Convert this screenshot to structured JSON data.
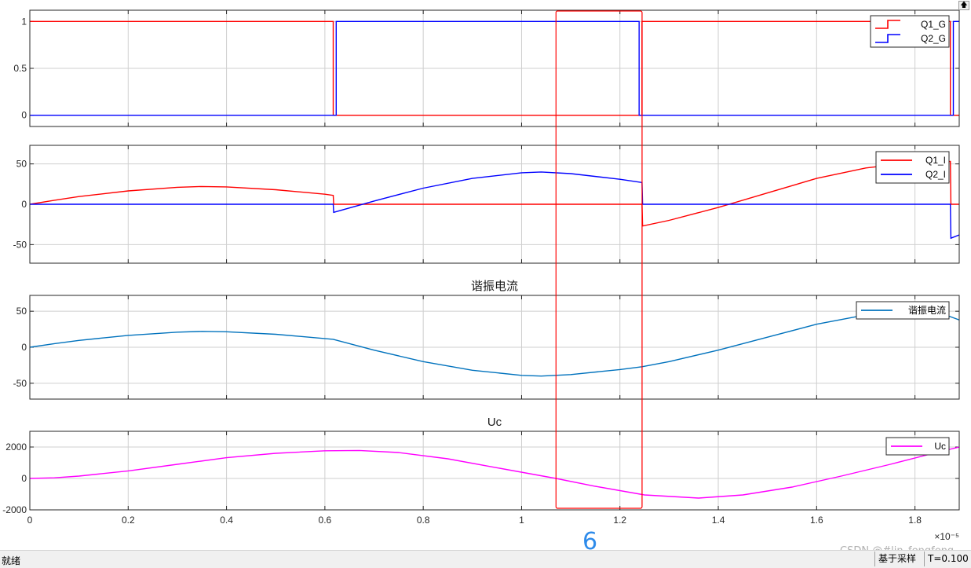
{
  "window": {
    "top_button_icon": "arrow-up-icon",
    "status": {
      "text": "就绪",
      "mode": "基于采样",
      "time": "T=0.100"
    }
  },
  "annotation": {
    "number": "6",
    "color": "#ff0000",
    "x_range": [
      1.07,
      1.245
    ]
  },
  "watermark": "CSDN @#lin_fengfeng",
  "x_exponent_label": "×10⁻⁵",
  "x_ticks": [
    0,
    0.2,
    0.4,
    0.6,
    0.8,
    1,
    1.2,
    1.4,
    1.6,
    1.8
  ],
  "x_tick_labels": [
    "0",
    "0.2",
    "0.4",
    "0.6",
    "0.8",
    "1",
    "1.2",
    "1.4",
    "1.6",
    "1.8"
  ],
  "chart_data": [
    {
      "type": "line",
      "title": "",
      "xlim": [
        0,
        1.89
      ],
      "ylim": [
        -0.12,
        1.12
      ],
      "yticks": [
        0,
        0.5,
        1
      ],
      "ytick_labels": [
        "0",
        "0.5",
        "1"
      ],
      "grid": true,
      "legend_position": "top-right",
      "series": [
        {
          "name": "Q1_G",
          "color": "#ff0000",
          "x": [
            0,
            0.617,
            0.617,
            1.245,
            1.245,
            1.872,
            1.872,
            1.89
          ],
          "y": [
            1,
            1,
            0,
            0,
            1,
            1,
            0,
            0
          ]
        },
        {
          "name": "Q2_G",
          "color": "#0000ff",
          "x": [
            0,
            0.623,
            0.623,
            1.239,
            1.239,
            1.878,
            1.878,
            1.89
          ],
          "y": [
            0,
            0,
            1,
            1,
            0,
            0,
            1,
            1
          ]
        }
      ]
    },
    {
      "type": "line",
      "title": "",
      "xlim": [
        0,
        1.89
      ],
      "ylim": [
        -73,
        73
      ],
      "yticks": [
        -50,
        0,
        50
      ],
      "ytick_labels": [
        "-50",
        "0",
        "50"
      ],
      "grid": true,
      "legend_position": "top-right",
      "series": [
        {
          "name": "Q1_I",
          "color": "#ff0000",
          "x": [
            0,
            0.05,
            0.1,
            0.2,
            0.3,
            0.35,
            0.4,
            0.5,
            0.6,
            0.617,
            0.618,
            1.245,
            1.246,
            1.3,
            1.4,
            1.5,
            1.6,
            1.7,
            1.8,
            1.872,
            1.873,
            1.89
          ],
          "y": [
            0,
            5,
            9.5,
            16.5,
            21,
            22,
            21.5,
            18,
            12.5,
            11,
            0,
            0,
            -27,
            -20,
            -4,
            14,
            32,
            45,
            52,
            53,
            0,
            0
          ]
        },
        {
          "name": "Q2_I",
          "color": "#0000ff",
          "x": [
            0,
            0.617,
            0.618,
            0.7,
            0.8,
            0.9,
            1.0,
            1.04,
            1.1,
            1.2,
            1.245,
            1.246,
            1.872,
            1.873,
            1.89
          ],
          "y": [
            0,
            0,
            -10,
            4,
            20,
            32,
            39,
            40,
            38,
            31,
            27,
            0,
            0,
            -42,
            -38
          ]
        }
      ]
    },
    {
      "type": "line",
      "title": "谐振电流",
      "xlim": [
        0,
        1.89
      ],
      "ylim": [
        -72,
        72
      ],
      "yticks": [
        -50,
        0,
        50
      ],
      "ytick_labels": [
        "-50",
        "0",
        "50"
      ],
      "grid": true,
      "legend_position": "top-right",
      "series": [
        {
          "name": "谐振电流",
          "color": "#0072bd",
          "x": [
            0,
            0.05,
            0.1,
            0.2,
            0.3,
            0.35,
            0.4,
            0.5,
            0.617,
            0.7,
            0.8,
            0.9,
            1.0,
            1.04,
            1.1,
            1.2,
            1.245,
            1.3,
            1.4,
            1.5,
            1.6,
            1.7,
            1.8,
            1.85,
            1.89
          ],
          "y": [
            0,
            5,
            9.5,
            16.5,
            21,
            22,
            21.5,
            18,
            11,
            -4,
            -20,
            -32,
            -39,
            -40,
            -38,
            -31,
            -27,
            -20,
            -4,
            14,
            32,
            45,
            52,
            48,
            38
          ]
        }
      ]
    },
    {
      "type": "line",
      "title": "Uc",
      "xlim": [
        0,
        1.89
      ],
      "ylim": [
        -2000,
        3000
      ],
      "yticks": [
        -2000,
        0,
        2000
      ],
      "ytick_labels": [
        "-2000",
        "0",
        "2000"
      ],
      "grid": true,
      "legend_position": "top-right",
      "series": [
        {
          "name": "Uc",
          "color": "#ff00ff",
          "x": [
            0,
            0.05,
            0.1,
            0.2,
            0.3,
            0.4,
            0.5,
            0.6,
            0.67,
            0.75,
            0.85,
            0.95,
            1.07,
            1.15,
            1.25,
            1.36,
            1.45,
            1.55,
            1.65,
            1.75,
            1.85,
            1.89
          ],
          "y": [
            0,
            40,
            150,
            480,
            900,
            1320,
            1600,
            1760,
            1780,
            1650,
            1250,
            680,
            0,
            -500,
            -1050,
            -1250,
            -1050,
            -550,
            150,
            900,
            1700,
            2000
          ]
        }
      ]
    }
  ]
}
